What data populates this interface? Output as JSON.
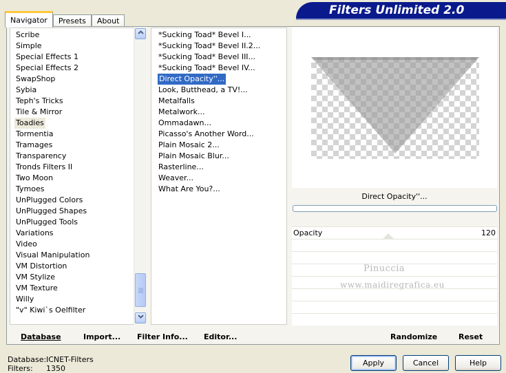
{
  "tabs": [
    {
      "label": "Navigator"
    },
    {
      "label": "Presets"
    },
    {
      "label": "About"
    }
  ],
  "banner": {
    "title": "Filters Unlimited 2.0"
  },
  "categories": [
    "Scribe",
    "Simple",
    "Special Effects 1",
    "Special Effects 2",
    "SwapShop",
    "Sybia",
    "Teph's Tricks",
    "Tile & Mirror",
    "Toadies",
    "Tormentia",
    "Tramages",
    "Transparency",
    "Tronds Filters II",
    "Two Moon",
    "Tymoes",
    "UnPlugged Colors",
    "UnPlugged Shapes",
    "UnPlugged Tools",
    "Variations",
    "Video",
    "Visual Manipulation",
    "VM Distortion",
    "VM Stylize",
    "VM Texture",
    "Willy",
    "\"v\" Kiwi`s Oelfilter"
  ],
  "selected_category": "Toadies",
  "filters": [
    "*Sucking Toad*  Bevel I...",
    "*Sucking Toad*  Bevel II.2...",
    "*Sucking Toad*  Bevel III...",
    "*Sucking Toad*  Bevel IV...",
    "Direct Opacity''...",
    "Look, Butthead, a TV!...",
    "Metalfalls",
    "Metalwork...",
    "Ommadawn...",
    "Picasso's Another Word...",
    "Plain Mosaic 2...",
    "Plain Mosaic Blur...",
    "Rasterline...",
    "Weaver...",
    "What Are You?..."
  ],
  "selected_filter": "Direct Opacity''...",
  "preview": {
    "filter_name": "Direct Opacity''..."
  },
  "parameters": [
    {
      "label": "Opacity",
      "value": "120"
    }
  ],
  "watermark": {
    "line1": "Pinuccia",
    "line2": "www.maidiregrafica.eu"
  },
  "bottom_buttons": {
    "database": "Database",
    "import": "Import...",
    "filter_info": "Filter Info...",
    "editor": "Editor...",
    "randomize": "Randomize",
    "reset": "Reset"
  },
  "status": {
    "database_label": "Database:",
    "database_value": "ICNET-Filters",
    "filters_label": "Filters:",
    "filters_value": "1350"
  },
  "dialog_buttons": {
    "apply": "Apply",
    "cancel": "Cancel",
    "help": "Help"
  },
  "icons": {
    "scroll_up": "chevron-up-icon",
    "scroll_down": "chevron-down-icon"
  }
}
